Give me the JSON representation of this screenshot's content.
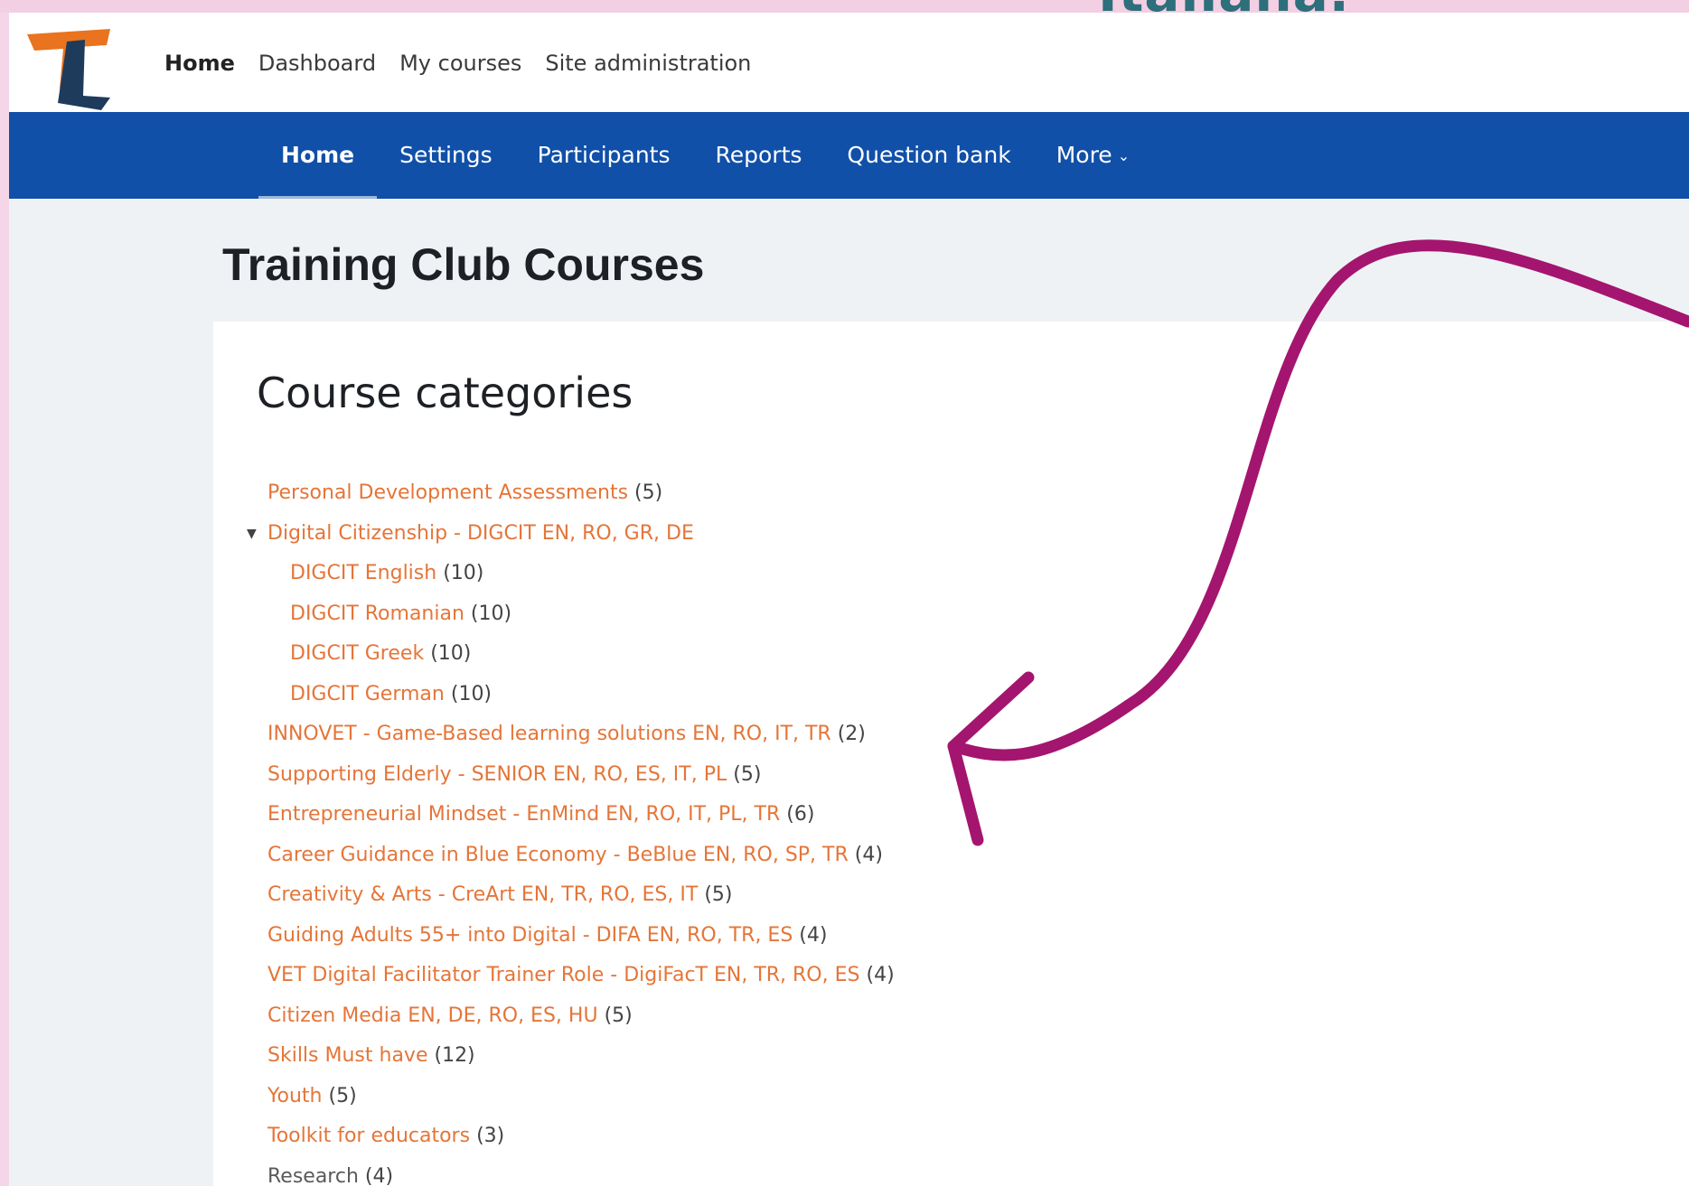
{
  "overlay": {
    "text": "Italiana."
  },
  "topnav": {
    "items": [
      {
        "label": "Home",
        "active": true
      },
      {
        "label": "Dashboard"
      },
      {
        "label": "My courses"
      },
      {
        "label": "Site administration"
      }
    ]
  },
  "secondary_nav": {
    "items": [
      {
        "label": "Home",
        "active": true
      },
      {
        "label": "Settings"
      },
      {
        "label": "Participants"
      },
      {
        "label": "Reports"
      },
      {
        "label": "Question bank"
      },
      {
        "label": "More"
      }
    ]
  },
  "page": {
    "title": "Training Club Courses"
  },
  "categories_card": {
    "title": "Course categories",
    "items": [
      {
        "name": "Personal Development Assessments",
        "count": "(5)"
      },
      {
        "name": "Digital Citizenship - DIGCIT EN, RO, GR, DE",
        "count": "",
        "expanded": true
      },
      {
        "name": "DIGCIT English",
        "count": "(10)",
        "sub": true
      },
      {
        "name": "DIGCIT Romanian",
        "count": "(10)",
        "sub": true
      },
      {
        "name": "DIGCIT Greek",
        "count": "(10)",
        "sub": true
      },
      {
        "name": "DIGCIT German",
        "count": "(10)",
        "sub": true
      },
      {
        "name": "INNOVET - Game-Based learning solutions EN, RO, IT, TR",
        "count": "(2)"
      },
      {
        "name": "Supporting Elderly - SENIOR EN, RO, ES, IT, PL",
        "count": "(5)"
      },
      {
        "name": "Entrepreneurial Mindset - EnMind EN, RO, IT, PL, TR",
        "count": "(6)"
      },
      {
        "name": "Career Guidance in Blue Economy - BeBlue EN, RO, SP, TR",
        "count": "(4)"
      },
      {
        "name": "Creativity & Arts - CreArt EN, TR, RO, ES, IT",
        "count": "(5)"
      },
      {
        "name": "Guiding Adults 55+ into Digital - DIFA EN, RO, TR, ES",
        "count": "(4)"
      },
      {
        "name": "VET Digital Facilitator Trainer Role - DigiFacT EN, TR, RO, ES",
        "count": "(4)"
      },
      {
        "name": "Citizen Media EN, DE, RO, ES, HU",
        "count": "(5)"
      },
      {
        "name": "Skills Must have",
        "count": "(12)"
      },
      {
        "name": "Youth",
        "count": "(5)"
      },
      {
        "name": "Toolkit for educators",
        "count": "(3)"
      },
      {
        "name": "Research",
        "count": "(4)",
        "muted": true
      }
    ]
  },
  "colors": {
    "nav_blue": "#1150a8",
    "link_orange": "#e57538",
    "annotation_magenta": "#a4156f",
    "background_pink": "#f5d6e8",
    "logo_orange": "#e9731e",
    "logo_navy": "#1f3b5c"
  },
  "icons": {
    "toggle": "caret-down-icon",
    "more_chevron": "chevron-down-icon",
    "logo": "tc-logo-icon"
  }
}
